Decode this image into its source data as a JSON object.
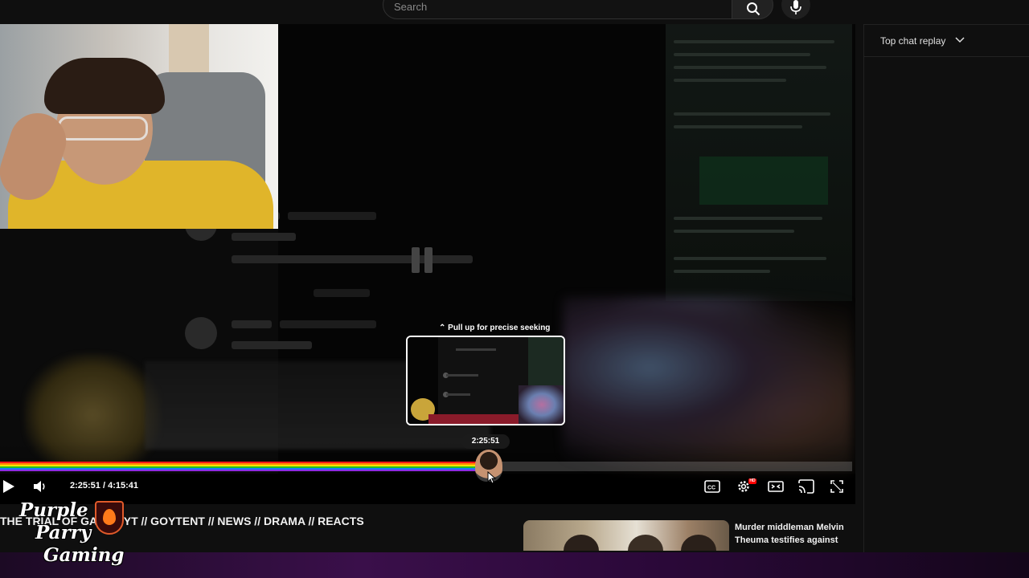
{
  "header": {
    "search_placeholder": "Search",
    "search_icon": "search-icon",
    "mic_icon": "mic-icon"
  },
  "player": {
    "seek_hint": "⌃ Pull up for precise seeking",
    "tooltip_time": "2:25:51",
    "current_time": "2:25:51",
    "duration": "4:15:41",
    "time_display": "2:25:51 / 4:15:41",
    "progress_fraction": 0.57,
    "hd_badge": "HD",
    "accent_colors": [
      "#ff1a1a",
      "#ff8c00",
      "#ffe600",
      "#22c322",
      "#1a7cff",
      "#8a2be2"
    ],
    "icons": [
      "play-icon",
      "volume-icon",
      "captions-icon",
      "settings-icon",
      "theater-mode-icon",
      "cast-icon",
      "fullscreen-icon"
    ]
  },
  "video": {
    "title": "THE TRIAL OF GAMONYT // GOYTENT // NEWS // DRAMA // REACTS"
  },
  "recommendation": {
    "title": "Murder middleman Melvin Theuma testifies against"
  },
  "chat": {
    "header": "Top chat replay"
  },
  "overlay": {
    "logo_lines": [
      "Purple",
      "Parry",
      "Gaming"
    ]
  }
}
